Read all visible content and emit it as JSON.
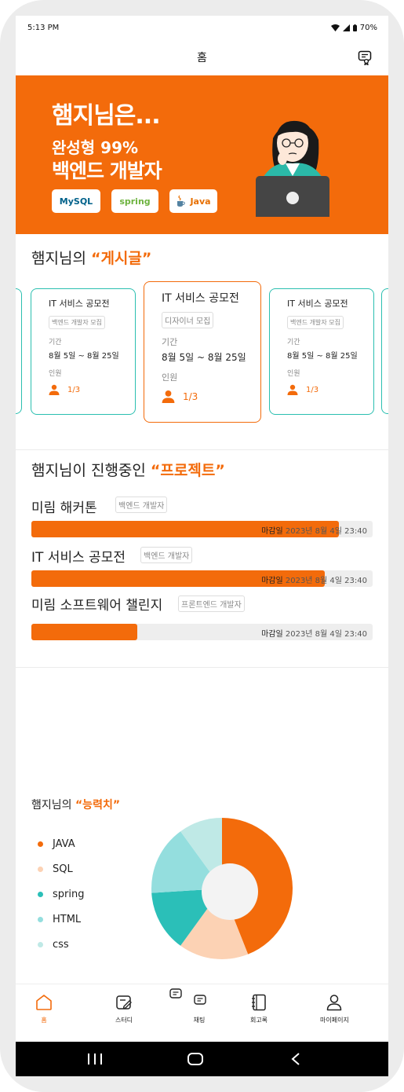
{
  "status": {
    "time": "5:13 PM",
    "battery": "70%"
  },
  "header": {
    "title": "홈"
  },
  "banner": {
    "line1": "햄지님은...",
    "line2": "완성형 99%",
    "line3": "백엔드 개발자",
    "badges": [
      "MySQL",
      "spring",
      "Java"
    ]
  },
  "posts": {
    "title_prefix": "햄지님의 ",
    "title_highlight": "“게시글”",
    "cards": [
      {
        "title": "IT 서비스 공모전",
        "tag": "백엔드 개발자 모집",
        "period_label": "기간",
        "period": "8월 5일 ~ 8월 25일",
        "people_label": "인원",
        "people": "1/3"
      },
      {
        "title": "IT 서비스 공모전",
        "tag": "디자이너 모집",
        "period_label": "기간",
        "period": "8월 5일 ~ 8월 25일",
        "people_label": "인원",
        "people": "1/3"
      },
      {
        "title": "IT 서비스 공모전",
        "tag": "백엔드 개발자 모집",
        "period_label": "기간",
        "period": "8월 5일 ~ 8월 25일",
        "people_label": "인원",
        "people": "1/3"
      }
    ]
  },
  "projects": {
    "title_prefix": "햄지님이 진행중인 ",
    "title_highlight": "“프로젝트”",
    "items": [
      {
        "name": "미림 해커톤",
        "tag": "백엔드 개발자",
        "deadline_label": "마감일",
        "deadline": "2023년 8월 4일 23:40",
        "progress": 0.9
      },
      {
        "name": "IT 서비스 공모전",
        "tag": "백엔드 개발자",
        "deadline_label": "마감일",
        "deadline": "2023년 8월 4일 23:40",
        "progress": 0.86
      },
      {
        "name": "미림 소프트웨어 챌린지",
        "tag": "프론트엔드 개발자",
        "deadline_label": "마감일",
        "deadline": "2023년 8월 4일 23:40",
        "progress": 0.31
      }
    ]
  },
  "stats": {
    "title_prefix": "햄지님의 ",
    "title_highlight": "“능력치”",
    "legend": [
      "JAVA",
      "SQL",
      "spring",
      "HTML",
      "css"
    ],
    "colors": [
      "#f36b0b",
      "#fcd2b4",
      "#2bbfb8",
      "#94dede",
      "#bfe9e6"
    ],
    "chart_data": {
      "type": "pie",
      "categories": [
        "JAVA",
        "SQL",
        "spring",
        "HTML",
        "css"
      ],
      "values": [
        44,
        16,
        14,
        16,
        10
      ]
    }
  },
  "nav": {
    "items": [
      {
        "label": "홈",
        "icon": "home-icon"
      },
      {
        "label": "스터디",
        "icon": "edit-icon"
      },
      {
        "label": "채팅",
        "icon": "chat-icon"
      },
      {
        "label": "회고록",
        "icon": "notebook-icon"
      },
      {
        "label": "마이페이지",
        "icon": "user-icon"
      }
    ]
  }
}
